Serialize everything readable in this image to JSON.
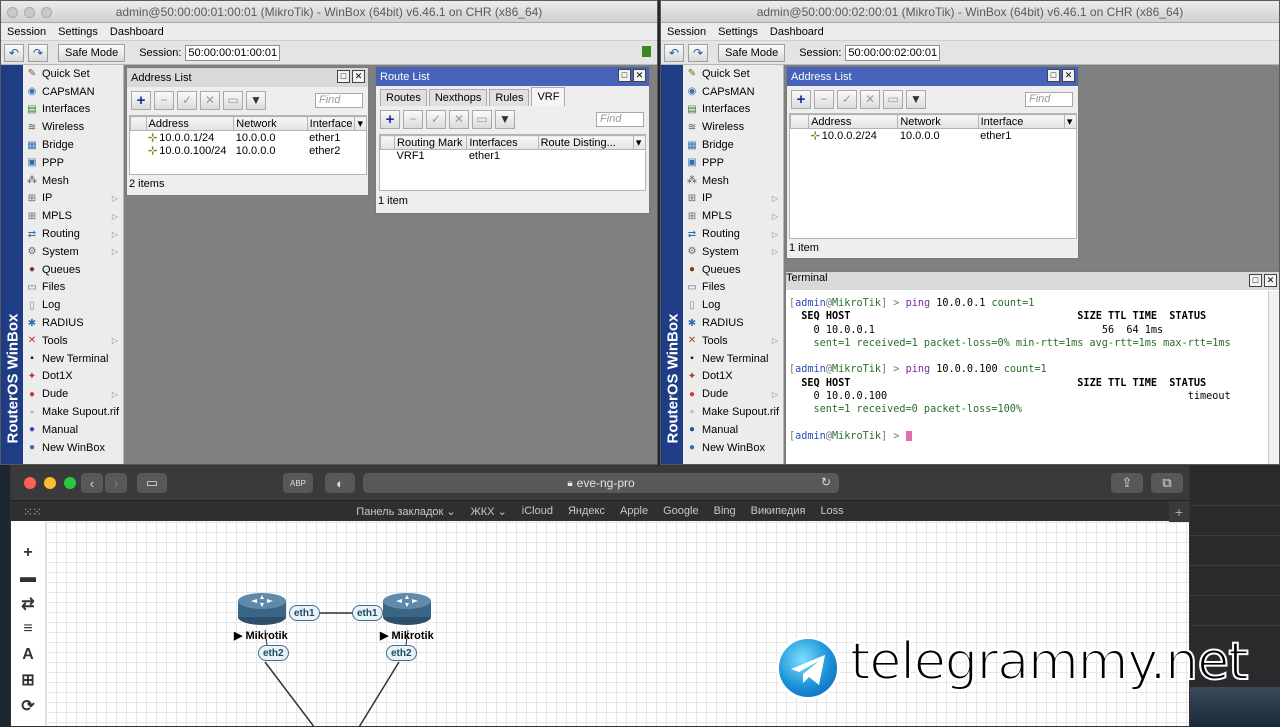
{
  "winbox1": {
    "title": "admin@50:00:00:01:00:01 (MikroTik) - WinBox (64bit) v6.46.1 on CHR (x86_64)",
    "menu": [
      "Session",
      "Settings",
      "Dashboard"
    ],
    "safe_mode": "Safe Mode",
    "session_label": "Session:",
    "session_value": "50:00:00:01:00:01",
    "address_list": {
      "title": "Address List",
      "find": "Find",
      "columns": [
        "Address",
        "Network",
        "Interface"
      ],
      "rows": [
        [
          "10.0.0.1/24",
          "10.0.0.0",
          "ether1"
        ],
        [
          "10.0.0.100/24",
          "10.0.0.0",
          "ether2"
        ]
      ],
      "status": "2 items"
    },
    "route_list": {
      "title": "Route List",
      "tabs": [
        "Routes",
        "Nexthops",
        "Rules",
        "VRF"
      ],
      "find": "Find",
      "columns": [
        "Routing Mark",
        "Interfaces",
        "Route Disting..."
      ],
      "rows": [
        [
          "VRF1",
          "ether1",
          ""
        ]
      ],
      "status": "1 item"
    }
  },
  "winbox2": {
    "title": "admin@50:00:00:02:00:01 (MikroTik) - WinBox (64bit) v6.46.1 on CHR (x86_64)",
    "menu": [
      "Session",
      "Settings",
      "Dashboard"
    ],
    "safe_mode": "Safe Mode",
    "session_label": "Session:",
    "session_value": "50:00:00:02:00:01",
    "address_list": {
      "title": "Address List",
      "find": "Find",
      "columns": [
        "Address",
        "Network",
        "Interface"
      ],
      "rows": [
        [
          "10.0.0.2/24",
          "10.0.0.0",
          "ether1"
        ]
      ],
      "status": "1 item"
    },
    "terminal": {
      "title": "Terminal",
      "lines": {
        "p1_user": "admin",
        "p1_host": "MikroTik",
        "p1_cmd": "ping",
        "p1_ip": "10.0.0.1",
        "p1_arg": "count=1",
        "hdr_left": "SEQ HOST",
        "hdr_right": "SIZE TTL TIME  STATUS",
        "r1_left": "  0 10.0.0.1",
        "r1_right": "  56  64 1ms",
        "s1": "    sent=1 received=1 packet-loss=0% min-rtt=1ms avg-rtt=1ms max-rtt=1ms",
        "p2_user": "admin",
        "p2_host": "MikroTik",
        "p2_cmd": "ping",
        "p2_ip": "10.0.0.100",
        "p2_arg": "count=1",
        "r2_left": "  0 10.0.0.100",
        "r2_right": "timeout",
        "s2": "    sent=1 received=0 packet-loss=100%",
        "p3_user": "admin",
        "p3_host": "MikroTik"
      }
    }
  },
  "side_menu": {
    "brand": "RouterOS WinBox",
    "items": [
      {
        "label": "Quick Set",
        "icon": "quick-set-icon",
        "glyph": "✎",
        "color": "#7a5a1a",
        "arrow": false
      },
      {
        "label": "CAPsMAN",
        "icon": "capsman-icon",
        "glyph": "◉",
        "color": "#3a6fb0",
        "arrow": false
      },
      {
        "label": "Interfaces",
        "icon": "interfaces-icon",
        "glyph": "▤",
        "color": "#2f7d2f",
        "arrow": false
      },
      {
        "label": "Wireless",
        "icon": "wireless-icon",
        "glyph": "≋",
        "color": "#555",
        "arrow": false
      },
      {
        "label": "Bridge",
        "icon": "bridge-icon",
        "glyph": "▦",
        "color": "#2f6fb0",
        "arrow": false
      },
      {
        "label": "PPP",
        "icon": "ppp-icon",
        "glyph": "▣",
        "color": "#2f6fb0",
        "arrow": false
      },
      {
        "label": "Mesh",
        "icon": "mesh-icon",
        "glyph": "⁂",
        "color": "#555",
        "arrow": false
      },
      {
        "label": "IP",
        "icon": "ip-icon",
        "glyph": "⊞",
        "color": "#666",
        "arrow": true
      },
      {
        "label": "MPLS",
        "icon": "mpls-icon",
        "glyph": "⊞",
        "color": "#666",
        "arrow": true
      },
      {
        "label": "Routing",
        "icon": "routing-icon",
        "glyph": "⇄",
        "color": "#2f6fb0",
        "arrow": true
      },
      {
        "label": "System",
        "icon": "system-icon",
        "glyph": "⚙",
        "color": "#666",
        "arrow": true
      },
      {
        "label": "Queues",
        "icon": "queues-icon",
        "glyph": "●",
        "color": "#7a3a1a",
        "arrow": false
      },
      {
        "label": "Files",
        "icon": "files-icon",
        "glyph": "▭",
        "color": "#3a6fb0",
        "arrow": false
      },
      {
        "label": "Log",
        "icon": "log-icon",
        "glyph": "▯",
        "color": "#888",
        "arrow": false
      },
      {
        "label": "RADIUS",
        "icon": "radius-icon",
        "glyph": "✱",
        "color": "#2f6fb0",
        "arrow": false
      },
      {
        "label": "Tools",
        "icon": "tools-icon",
        "glyph": "✕",
        "color": "#b03a2a",
        "arrow": true
      },
      {
        "label": "New Terminal",
        "icon": "terminal-icon",
        "glyph": "▪",
        "color": "#222",
        "arrow": false
      },
      {
        "label": "Dot1X",
        "icon": "dot1x-icon",
        "glyph": "✦",
        "color": "#b03a2a",
        "arrow": false
      },
      {
        "label": "Dude",
        "icon": "dude-icon",
        "glyph": "●",
        "color": "#d03a2a",
        "arrow": true
      },
      {
        "label": "Make Supout.rif",
        "icon": "supout-icon",
        "glyph": "▫",
        "color": "#666",
        "arrow": false
      },
      {
        "label": "Manual",
        "icon": "manual-icon",
        "glyph": "●",
        "color": "#2f4fb0",
        "arrow": false
      },
      {
        "label": "New WinBox",
        "icon": "new-winbox-icon",
        "glyph": "●",
        "color": "#2f6fb0",
        "arrow": false
      }
    ]
  },
  "safari": {
    "url": "eve-ng-pro",
    "abp": "ABP",
    "favorites": [
      "Панель закладок ⌄",
      "ЖКХ ⌄",
      "iCloud",
      "Яндекс",
      "Apple",
      "Google",
      "Bing",
      "Википедия",
      "Loss"
    ],
    "eve_tools": [
      "+",
      "▬",
      "⇄",
      "≡",
      "A",
      "⊞",
      "⟳"
    ],
    "topology": {
      "left_router": "Mikrotik",
      "right_router": "Mikrotik",
      "left_eth1": "eth1",
      "right_eth1": "eth1",
      "left_eth2": "eth2",
      "right_eth2": "eth2"
    }
  },
  "watermark": "telegrammy.net"
}
